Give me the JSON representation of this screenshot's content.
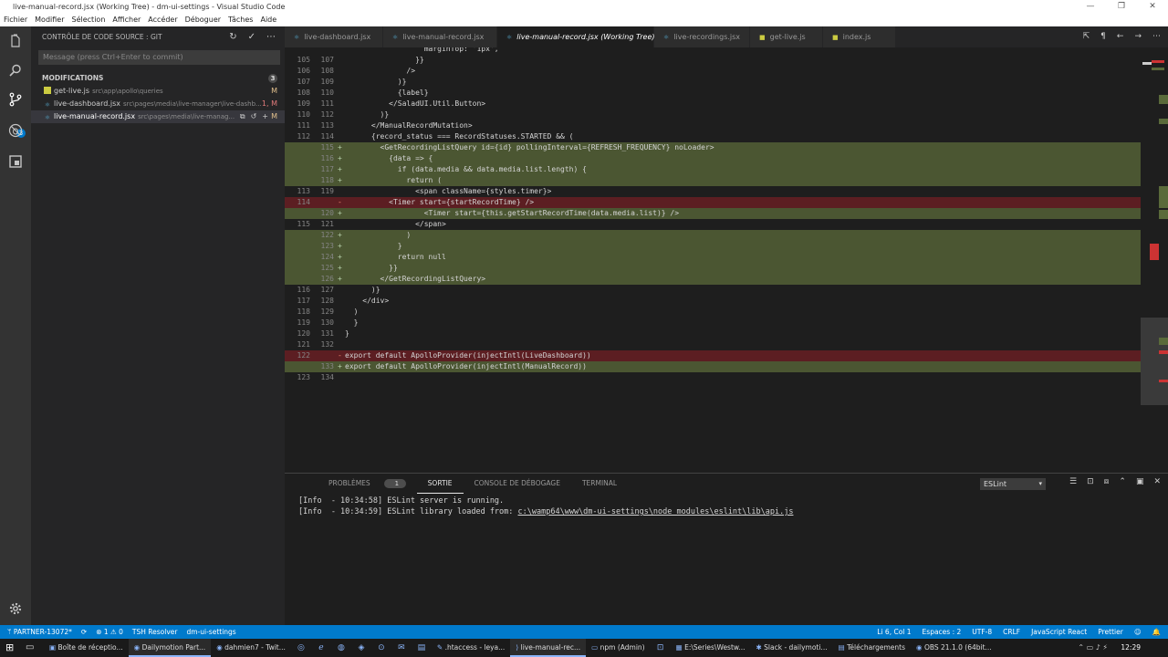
{
  "window": {
    "title": "live-manual-record.jsx (Working Tree) - dm-ui-settings - Visual Studio Code",
    "controls": [
      "—",
      "❐",
      "✕"
    ]
  },
  "menu": [
    "Fichier",
    "Modifier",
    "Sélection",
    "Afficher",
    "Accéder",
    "Déboguer",
    "Tâches",
    "Aide"
  ],
  "activity_bar": {
    "badge": "3",
    "icons": [
      "files-icon",
      "search-icon",
      "source-control-icon",
      "debug-icon",
      "extensions-icon",
      "gear-icon"
    ]
  },
  "sidebar": {
    "header": "CONTRÔLE DE CODE SOURCE : GIT",
    "commit_placeholder": "Message (press Ctrl+Enter to commit)",
    "changes_label": "MODIFICATIONS",
    "changes_count": "3",
    "files": [
      {
        "name": "get-live.js",
        "path": "src\\app\\apollo\\queries",
        "status": "M",
        "type": "js"
      },
      {
        "name": "live-dashboard.jsx",
        "path": "src\\pages\\media\\live-manager\\live-dashb...",
        "status": "1, M",
        "type": "jsx"
      },
      {
        "name": "live-manual-record.jsx",
        "path": "src\\pages\\media\\live-manag...",
        "status": "M",
        "type": "jsx"
      }
    ]
  },
  "tabs": [
    {
      "label": "live-dashboard.jsx",
      "type": "jsx",
      "active": false
    },
    {
      "label": "live-manual-record.jsx",
      "type": "jsx",
      "active": false
    },
    {
      "label": "live-manual-record.jsx (Working Tree)",
      "type": "jsx",
      "active": true
    },
    {
      "label": "live-recordings.jsx",
      "type": "jsx",
      "active": false
    },
    {
      "label": "get-live.js",
      "type": "js",
      "active": false
    },
    {
      "label": "index.js",
      "type": "js",
      "active": false
    }
  ],
  "diff_lines": [
    {
      "l": "",
      "r": "",
      "m": "",
      "k": "",
      "c": "                  marginTop: '1px',"
    },
    {
      "l": "105",
      "r": "107",
      "m": "",
      "k": "",
      "c": "                }}"
    },
    {
      "l": "106",
      "r": "108",
      "m": "",
      "k": "",
      "c": "              />"
    },
    {
      "l": "107",
      "r": "109",
      "m": "",
      "k": "",
      "c": "            )}"
    },
    {
      "l": "108",
      "r": "110",
      "m": "",
      "k": "",
      "c": "            {label}"
    },
    {
      "l": "109",
      "r": "111",
      "m": "",
      "k": "",
      "c": "          </SaladUI.Util.Button>"
    },
    {
      "l": "110",
      "r": "112",
      "m": "",
      "k": "",
      "c": "        )}"
    },
    {
      "l": "111",
      "r": "113",
      "m": "",
      "k": "",
      "c": "      </ManualRecordMutation>"
    },
    {
      "l": "112",
      "r": "114",
      "m": "",
      "k": "",
      "c": "      {record_status === RecordStatuses.STARTED && ("
    },
    {
      "l": "",
      "r": "115",
      "m": "+",
      "k": "add",
      "c": "        <GetRecordingListQuery id={id} pollingInterval={REFRESH_FREQUENCY} noLoader>"
    },
    {
      "l": "",
      "r": "116",
      "m": "+",
      "k": "add",
      "c": "          {data => {"
    },
    {
      "l": "",
      "r": "117",
      "m": "+",
      "k": "add",
      "c": "            if (data.media && data.media.list.length) {"
    },
    {
      "l": "",
      "r": "118",
      "m": "+",
      "k": "add",
      "c": "              return ("
    },
    {
      "l": "113",
      "r": "119",
      "m": "",
      "k": "",
      "c": "                <span className={styles.timer}>"
    },
    {
      "l": "114",
      "r": "",
      "m": "-",
      "k": "del",
      "c": "          <Timer start={startRecordTime} />"
    },
    {
      "l": "",
      "r": "120",
      "m": "+",
      "k": "add",
      "c": "                  <Timer start={this.getStartRecordTime(data.media.list)} />"
    },
    {
      "l": "115",
      "r": "121",
      "m": "",
      "k": "",
      "c": "                </span>"
    },
    {
      "l": "",
      "r": "122",
      "m": "+",
      "k": "add",
      "c": "              )"
    },
    {
      "l": "",
      "r": "123",
      "m": "+",
      "k": "add",
      "c": "            }"
    },
    {
      "l": "",
      "r": "124",
      "m": "+",
      "k": "add",
      "c": "            return null"
    },
    {
      "l": "",
      "r": "125",
      "m": "+",
      "k": "add",
      "c": "          }}"
    },
    {
      "l": "",
      "r": "126",
      "m": "+",
      "k": "add",
      "c": "        </GetRecordingListQuery>"
    },
    {
      "l": "116",
      "r": "127",
      "m": "",
      "k": "",
      "c": "      )}"
    },
    {
      "l": "117",
      "r": "128",
      "m": "",
      "k": "",
      "c": "    </div>"
    },
    {
      "l": "118",
      "r": "129",
      "m": "",
      "k": "",
      "c": "  )"
    },
    {
      "l": "119",
      "r": "130",
      "m": "",
      "k": "",
      "c": "  }"
    },
    {
      "l": "120",
      "r": "131",
      "m": "",
      "k": "",
      "c": "}"
    },
    {
      "l": "121",
      "r": "132",
      "m": "",
      "k": "",
      "c": ""
    },
    {
      "l": "122",
      "r": "",
      "m": "-",
      "k": "del",
      "c": "export default ApolloProvider(injectIntl(LiveDashboard))"
    },
    {
      "l": "",
      "r": "133",
      "m": "+",
      "k": "add",
      "c": "export default ApolloProvider(injectIntl(ManualRecord))"
    },
    {
      "l": "123",
      "r": "134",
      "m": "",
      "k": "",
      "c": ""
    }
  ],
  "panel": {
    "tabs": [
      {
        "label": "PROBLÈMES",
        "count": "1"
      },
      {
        "label": "SORTIE",
        "count": ""
      },
      {
        "label": "CONSOLE DE DÉBOGAGE",
        "count": ""
      },
      {
        "label": "TERMINAL",
        "count": ""
      }
    ],
    "active_tab": "SORTIE",
    "output_channel": "ESLint",
    "output_lines": [
      "[Info  - 10:34:58] ESLint server is running.",
      "[Info  - 10:34:59] ESLint library loaded from: "
    ],
    "output_link": "c:\\wamp64\\www\\dm-ui-settings\\node_modules\\eslint\\lib\\api.js"
  },
  "statusbar": {
    "left": [
      "ᛘ PARTNER-13072*",
      "⟳",
      "⊗ 1 ⚠ 0",
      "TSH Resolver",
      "dm-ui-settings"
    ],
    "right": [
      "Li 6, Col 1",
      "Espaces : 2",
      "UTF-8",
      "CRLF",
      "JavaScript React",
      "Prettier",
      "☺",
      "🔔"
    ]
  },
  "taskbar": {
    "items": [
      {
        "label": "Boîte de réceptio...",
        "open": false
      },
      {
        "label": "Dailymotion Part...",
        "open": true
      },
      {
        "label": "dahmien7 - Twit...",
        "open": false
      },
      {
        "label": "",
        "open": false
      },
      {
        "label": "",
        "open": false
      },
      {
        "label": "",
        "open": false
      },
      {
        "label": "",
        "open": false
      },
      {
        "label": "",
        "open": false
      },
      {
        "label": "",
        "open": false
      },
      {
        "label": "",
        "open": false
      },
      {
        "label": ".htaccess - leya...",
        "open": false
      },
      {
        "label": "live-manual-rec...",
        "open": true
      },
      {
        "label": "npm (Admin)",
        "open": false
      },
      {
        "label": "",
        "open": false
      },
      {
        "label": "E:\\Series\\Westw...",
        "open": false
      },
      {
        "label": "Slack - dailymoti...",
        "open": false
      },
      {
        "label": "Téléchargements",
        "open": false
      },
      {
        "label": "OBS 21.1.0 (64bit...",
        "open": false
      }
    ],
    "clock": "12:29"
  },
  "colors": {
    "accent": "#007acc",
    "added_bg": "#4b5632",
    "removed_bg": "#5c1e22"
  }
}
